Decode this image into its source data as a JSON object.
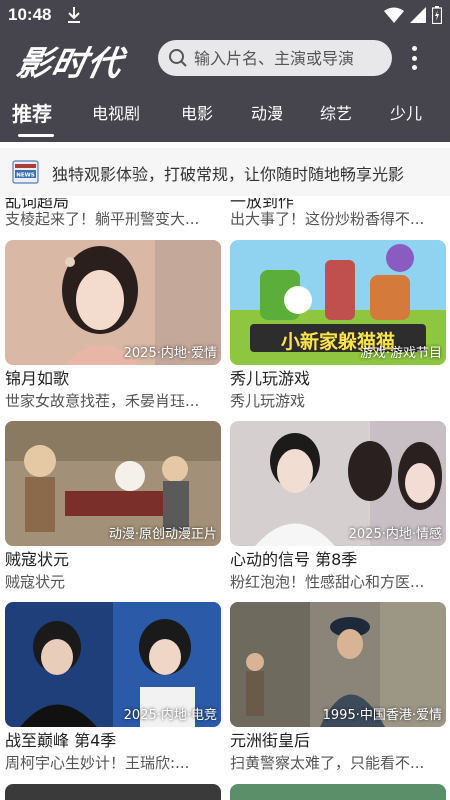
{
  "status": {
    "time": "10:48"
  },
  "header": {
    "logo": "影时代",
    "search_placeholder": "输入片名、主演或导演"
  },
  "tabs": [
    "推荐",
    "电视剧",
    "电影",
    "动漫",
    "综艺",
    "少儿"
  ],
  "notice": {
    "icon": "news-icon",
    "icon_text": "NEWS",
    "text": "独特观影体验，打破常规，让你随时随地畅享光影"
  },
  "cut_row": [
    {
      "title": "乱词超局",
      "subtitle": "支棱起来了！躺平刑警变大..."
    },
    {
      "title": "一放到作",
      "subtitle": "出大事了！这份炒粉香得不..."
    }
  ],
  "cards": [
    {
      "title": "锦月如歌",
      "subtitle": "世家女故意找茬，禾晏肖珏...",
      "tag": "2025·内地·爱情"
    },
    {
      "title": "秀儿玩游戏",
      "subtitle": "秀儿玩游戏",
      "tag": "游戏·游戏节目",
      "thumb_caption": "小新家躲猫猫"
    },
    {
      "title": "贼寇状元",
      "subtitle": "贼寇状元",
      "tag": "动漫·原创动漫正片"
    },
    {
      "title": "心动的信号 第8季",
      "subtitle": "粉红泡泡！性感甜心和方医...",
      "tag": "2025·内地·情感"
    },
    {
      "title": "战至巅峰 第4季",
      "subtitle": "周柯宇心生妙计！王瑞欣:...",
      "tag": "2025·内地·电竞"
    },
    {
      "title": "元洲街皇后",
      "subtitle": "扫黄警察太难了，只能看不...",
      "tag": "1995·中国香港·爱情"
    }
  ]
}
